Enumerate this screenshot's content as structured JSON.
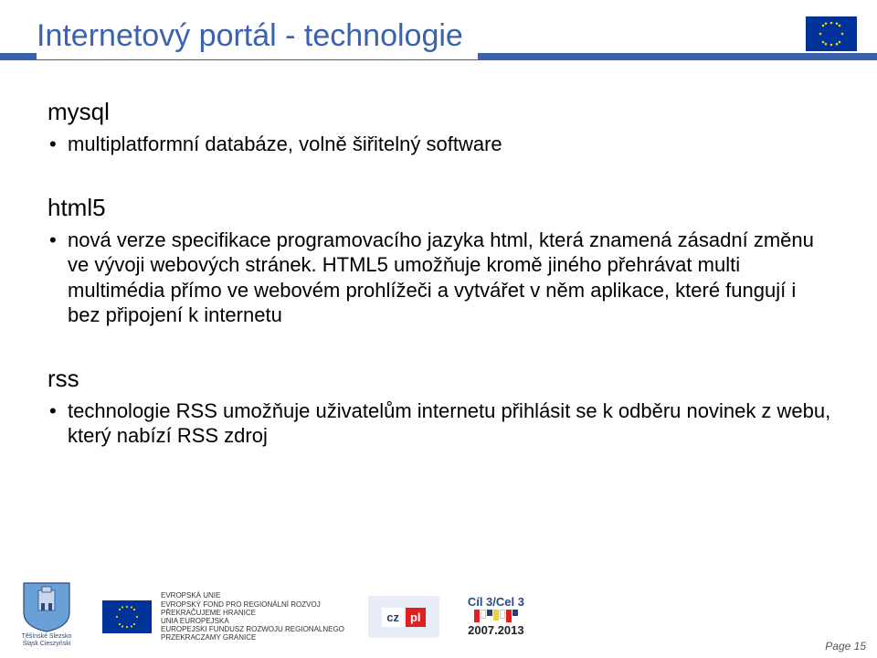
{
  "title": "Internetový portál - technologie",
  "sections": {
    "mysql": {
      "label": "mysql",
      "item": "multiplatformní databáze, volně šiřitelný software"
    },
    "html5": {
      "label": "html5",
      "item": "nová verze specifikace programovacího jazyka html, která znamená zásadní změnu ve vývoji webových stránek. HTML5 umožňuje kromě jiného přehrávat multi multimédia přímo ve webovém prohlížeči a vytvářet v něm aplikace, které fungují i bez připojení k internetu"
    },
    "rss": {
      "label": "rss",
      "item": "technologie RSS umožňuje uživatelům internetu přihlásit se k odběru novinek z webu, který nabízí RSS zdroj"
    }
  },
  "footer": {
    "shield_line1": "Těšínské Slezsko",
    "shield_line2": "Śląsk Cieszyński",
    "eu_text": "EVROPSKÁ UNIE\nEVROPSKÝ FOND PRO REGIONÁLNÍ ROZVOJ\nPŘEKRAČUJEME HRANICE\nUNIA EUROPEJSKA\nEUROPEJSKI FUNDUSZ ROZWOJU REGIONALNEGO\nPRZEKRACZAMY GRANICE",
    "cz": "cz",
    "pl": "pl",
    "cil_top": "Cíl 3/Cel 3",
    "cil_btm": "2007.2013"
  },
  "page_number": "Page 15"
}
